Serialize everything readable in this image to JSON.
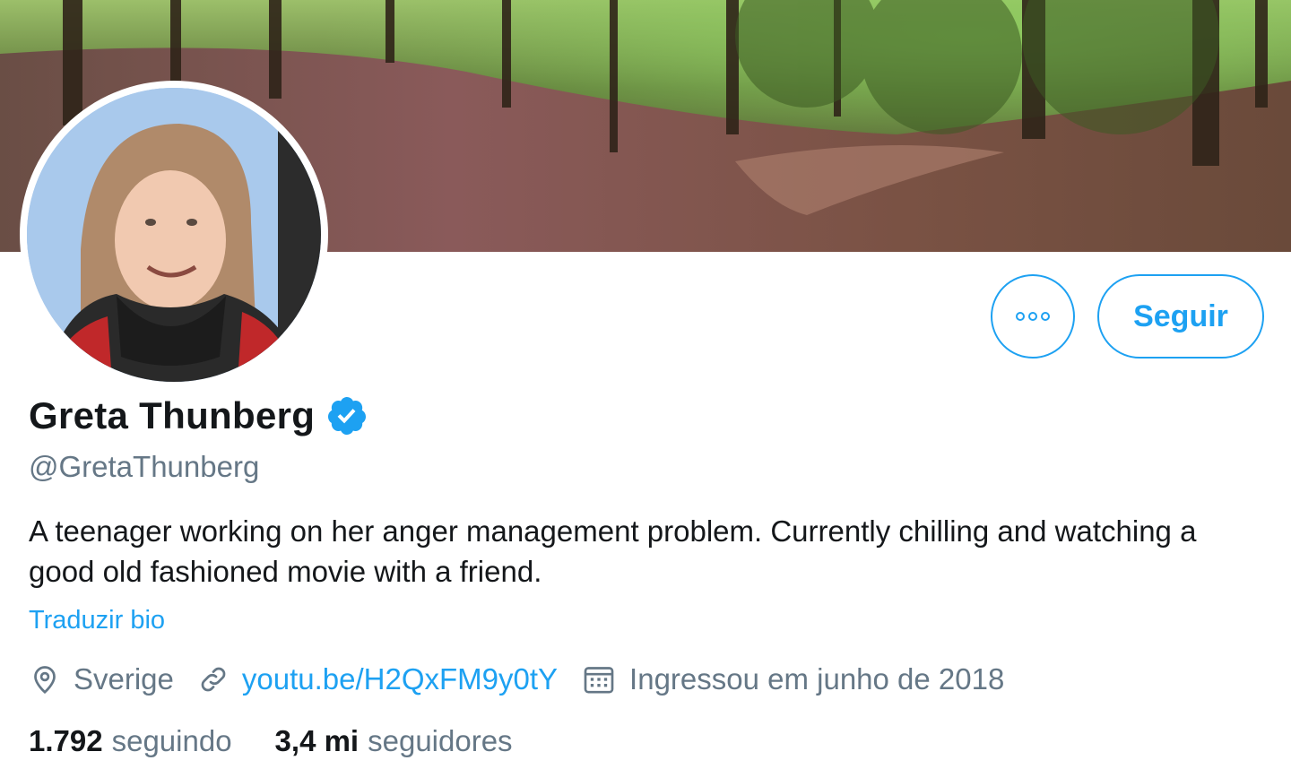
{
  "profile": {
    "display_name": "Greta Thunberg",
    "handle": "@GretaThunberg",
    "bio": "A teenager working on her anger management problem. Currently chilling and watching a good old fashioned movie with a friend.",
    "translate_link": "Traduzir bio",
    "location": "Sverige",
    "website": "youtu.be/H2QxFM9y0tY",
    "joined": "Ingressou em junho de 2018",
    "following_count": "1.792",
    "following_label": "seguindo",
    "followers_count": "3,4 mi",
    "followers_label": "seguidores"
  },
  "actions": {
    "follow_label": "Seguir"
  },
  "icons": {
    "verified": "verified-badge-icon",
    "more": "more-options-icon",
    "location": "location-pin-icon",
    "link": "link-icon",
    "calendar": "calendar-icon"
  },
  "colors": {
    "accent": "#1da1f2",
    "text_primary": "#14171a",
    "text_secondary": "#657786"
  }
}
